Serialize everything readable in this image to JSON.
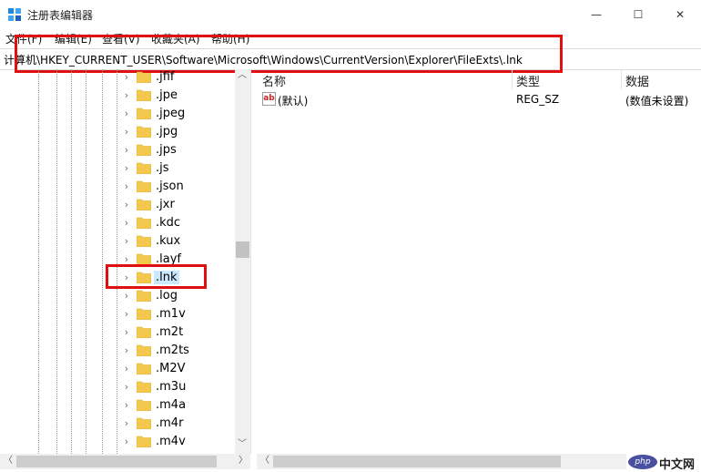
{
  "window": {
    "title": "注册表编辑器",
    "minimize_glyph": "—",
    "maximize_glyph": "☐",
    "close_glyph": "✕"
  },
  "menu": [
    {
      "label": "文件(F)"
    },
    {
      "label": "编辑(E)"
    },
    {
      "label": "查看(V)"
    },
    {
      "label": "收藏夹(A)"
    },
    {
      "label": "帮助(H)"
    }
  ],
  "address": {
    "path": "计算机\\HKEY_CURRENT_USER\\Software\\Microsoft\\Windows\\CurrentVersion\\Explorer\\FileExts\\.lnk"
  },
  "tree": {
    "items": [
      {
        "label": ".jfif"
      },
      {
        "label": ".jpe"
      },
      {
        "label": ".jpeg"
      },
      {
        "label": ".jpg"
      },
      {
        "label": ".jps"
      },
      {
        "label": ".js"
      },
      {
        "label": ".json"
      },
      {
        "label": ".jxr"
      },
      {
        "label": ".kdc"
      },
      {
        "label": ".kux"
      },
      {
        "label": ".layf"
      },
      {
        "label": ".lnk"
      },
      {
        "label": ".log"
      },
      {
        "label": ".m1v"
      },
      {
        "label": ".m2t"
      },
      {
        "label": ".m2ts"
      },
      {
        "label": ".M2V"
      },
      {
        "label": ".m3u"
      },
      {
        "label": ".m4a"
      },
      {
        "label": ".m4r"
      },
      {
        "label": ".m4v"
      }
    ],
    "selected": ".lnk"
  },
  "values_table": {
    "columns": [
      "名称",
      "类型",
      "数据"
    ],
    "rows": [
      {
        "name": "(默认)",
        "type": "REG_SZ",
        "data": "(数值未设置)",
        "icon": "string-value-icon"
      }
    ]
  },
  "watermark": {
    "logo": "php",
    "text": "中文网"
  },
  "colors": {
    "highlight": "#e01010",
    "folder": "#f2c94c",
    "selection": "#cce8ff"
  }
}
